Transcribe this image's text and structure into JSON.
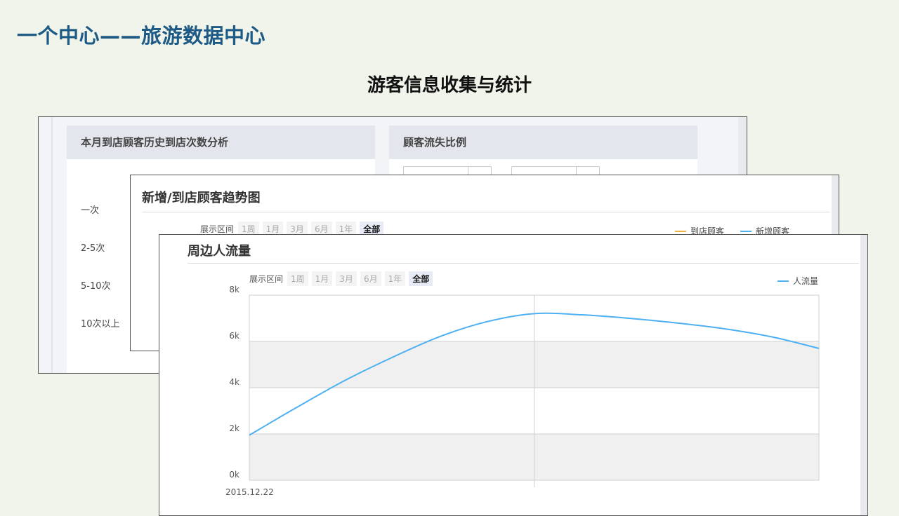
{
  "slide": {
    "title": "一个中心——旅游数据中心",
    "subtitle": "游客信息收集与统计"
  },
  "panel_history": {
    "title": "本月到店顾客历史到店次数分析",
    "rows": [
      "一次",
      "2-5次",
      "5-10次",
      "10次以上"
    ]
  },
  "panel_churn": {
    "title": "顾客流失比例"
  },
  "panel_trend": {
    "title": "新增/到店顾客趋势图",
    "range_label": "展示区间",
    "range_options": [
      "1周",
      "1月",
      "3月",
      "6月",
      "1年",
      "全部"
    ],
    "active_range": "全部",
    "legend": [
      {
        "name": "到店顾客",
        "color": "#f5b041"
      },
      {
        "name": "新增顾客",
        "color": "#4db0f2"
      }
    ]
  },
  "panel_traffic": {
    "title": "周边人流量",
    "range_label": "展示区间",
    "range_options": [
      "1周",
      "1月",
      "3月",
      "6月",
      "1年",
      "全部"
    ],
    "active_range": "全部",
    "legend": [
      {
        "name": "人流量",
        "color": "#4db0f2"
      }
    ]
  },
  "chart_data": {
    "type": "line",
    "x": [
      "2015.12.22",
      "",
      "",
      "",
      "",
      "",
      "",
      "",
      "",
      "",
      "",
      "",
      ""
    ],
    "x_tick_labels": [
      "2015.12.22"
    ],
    "series": [
      {
        "name": "人流量",
        "color": "#4db0f2",
        "values": [
          1950,
          3150,
          4300,
          5300,
          6200,
          6850,
          7200,
          7150,
          7000,
          6800,
          6550,
          6200,
          5700
        ]
      }
    ],
    "y_ticks": [
      "0k",
      "2k",
      "4k",
      "6k",
      "8k"
    ],
    "ylim": [
      0,
      8000
    ],
    "grid": true,
    "legend_position": "top-right"
  }
}
